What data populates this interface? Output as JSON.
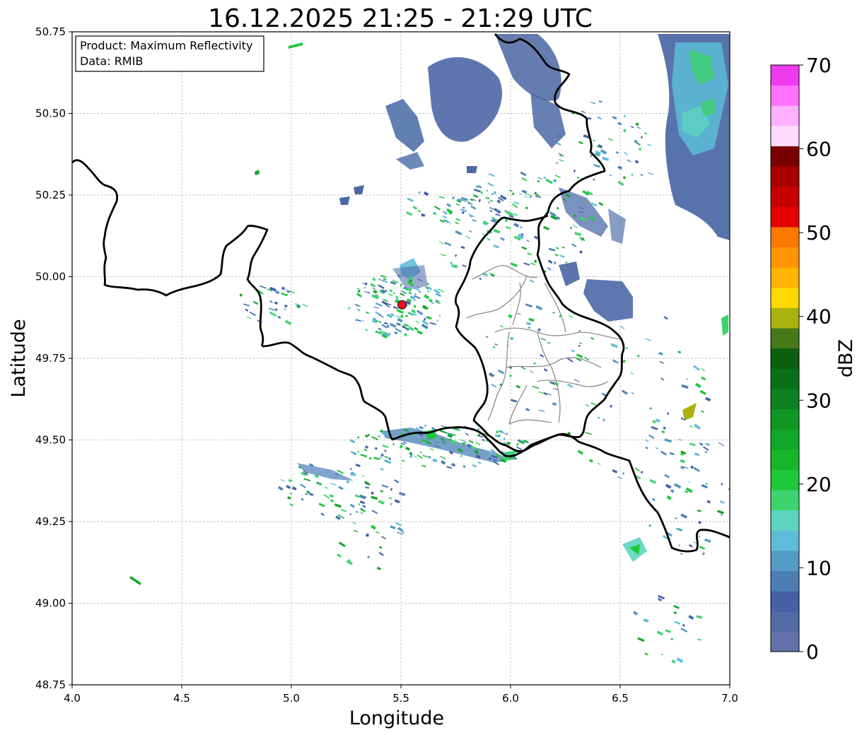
{
  "title": "16.12.2025 21:25 - 21:29 UTC",
  "info_box": {
    "product_line": "Product: Maximum Reflectivity",
    "data_line": "Data: RMIB"
  },
  "colorbar": {
    "label": "dBZ",
    "min": 0,
    "max": 70,
    "ticks": [
      "0",
      "10",
      "20",
      "30",
      "40",
      "50",
      "60",
      "70"
    ],
    "colors": [
      "#6272a8",
      "#526aa6",
      "#4660a4",
      "#4c7eb4",
      "#539ac4",
      "#5fbcd8",
      "#5dd5c0",
      "#3dd36e",
      "#1ec83a",
      "#16b62b",
      "#12a62a",
      "#0f9623",
      "#0d8020",
      "#0a7018",
      "#0b5e10",
      "#47781a",
      "#a9b10c",
      "#ffd800",
      "#ffb400",
      "#ff9500",
      "#ff7800",
      "#e30000",
      "#c40000",
      "#a80000",
      "#7a0000",
      "#ffdaff",
      "#ffb1ff",
      "#ff71ff",
      "#f03af0"
    ]
  },
  "map": {
    "xlabel": "Longitude",
    "ylabel": "Latitude",
    "xlim": [
      4.0,
      7.0
    ],
    "ylim": [
      48.75,
      50.75
    ],
    "xticks": [
      "4.0",
      "4.5",
      "5.0",
      "5.5",
      "6.0",
      "6.5",
      "7.0"
    ],
    "yticks": [
      "48.75",
      "49.00",
      "49.25",
      "49.50",
      "49.75",
      "50.00",
      "50.25",
      "50.50",
      "50.75"
    ],
    "grid": true,
    "radar_site": {
      "lon": 5.505,
      "lat": 49.914,
      "color": "#e8141c"
    }
  }
}
